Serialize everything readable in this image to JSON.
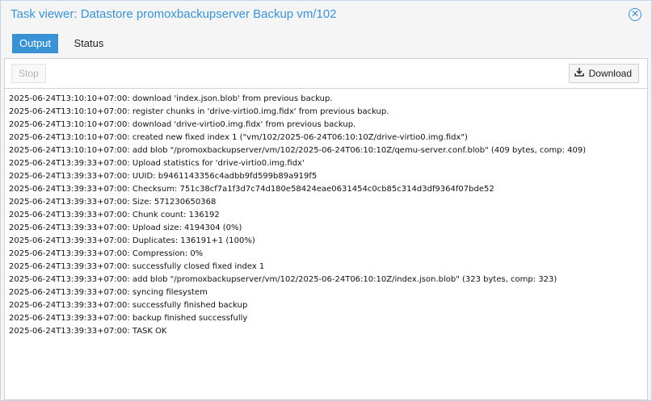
{
  "window": {
    "title": "Task viewer: Datastore promoxbackupserver Backup vm/102",
    "close_icon": "close-circle-icon"
  },
  "tabs": [
    {
      "label": "Output",
      "active": true
    },
    {
      "label": "Status",
      "active": false
    }
  ],
  "toolbar": {
    "stop_label": "Stop",
    "stop_disabled": true,
    "download_label": "Download",
    "download_icon": "download-icon"
  },
  "log": [
    "2025-06-24T13:10:10+07:00: download 'index.json.blob' from previous backup.",
    "2025-06-24T13:10:10+07:00: register chunks in 'drive-virtio0.img.fidx' from previous backup.",
    "2025-06-24T13:10:10+07:00: download 'drive-virtio0.img.fidx' from previous backup.",
    "2025-06-24T13:10:10+07:00: created new fixed index 1 (\"vm/102/2025-06-24T06:10:10Z/drive-virtio0.img.fidx\")",
    "2025-06-24T13:10:10+07:00: add blob \"/promoxbackupserver/vm/102/2025-06-24T06:10:10Z/qemu-server.conf.blob\" (409 bytes, comp: 409)",
    "2025-06-24T13:39:33+07:00: Upload statistics for 'drive-virtio0.img.fidx'",
    "2025-06-24T13:39:33+07:00: UUID: b9461143356c4adbb9fd599b89a919f5",
    "2025-06-24T13:39:33+07:00: Checksum: 751c38cf7a1f3d7c74d180e58424eae0631454c0cb85c314d3df9364f07bde52",
    "2025-06-24T13:39:33+07:00: Size: 571230650368",
    "2025-06-24T13:39:33+07:00: Chunk count: 136192",
    "2025-06-24T13:39:33+07:00: Upload size: 4194304 (0%)",
    "2025-06-24T13:39:33+07:00: Duplicates: 136191+1 (100%)",
    "2025-06-24T13:39:33+07:00: Compression: 0%",
    "2025-06-24T13:39:33+07:00: successfully closed fixed index 1",
    "2025-06-24T13:39:33+07:00: add blob \"/promoxbackupserver/vm/102/2025-06-24T06:10:10Z/index.json.blob\" (323 bytes, comp: 323)",
    "2025-06-24T13:39:33+07:00: syncing filesystem",
    "2025-06-24T13:39:33+07:00: successfully finished backup",
    "2025-06-24T13:39:33+07:00: backup finished successfully",
    "2025-06-24T13:39:33+07:00: TASK OK"
  ],
  "colors": {
    "accent": "#3892d4",
    "border": "#d0d0d0",
    "background": "#f5f5f5"
  }
}
